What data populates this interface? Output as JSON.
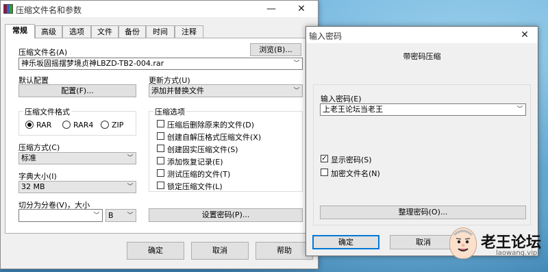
{
  "main_window": {
    "title": "压缩文件名和参数",
    "tabs": [
      "常规",
      "高级",
      "选项",
      "文件",
      "备份",
      "时间",
      "注释"
    ],
    "archive_name_label": "压缩文件名(A)",
    "browse_button": "浏览(B)...",
    "archive_name_value": "神乐坂固摇摆梦境贞神LBZD-TB2-004.rar",
    "default_profile_label": "默认配置",
    "profile_button": "配置(F)...",
    "update_mode_label": "更新方式(U)",
    "update_mode_value": "添加并替换文件",
    "format_group_title": "压缩文件格式",
    "format_options": [
      "RAR",
      "RAR4",
      "ZIP"
    ],
    "format_selected": "RAR",
    "method_label": "压缩方式(C)",
    "method_value": "标准",
    "dict_label": "字典大小(I)",
    "dict_value": "32 MB",
    "split_label": "切分为分卷(V)，大小",
    "split_value": "",
    "split_unit": "B",
    "options_group_title": "压缩选项",
    "options": [
      {
        "label": "压缩后删除原来的文件(D)",
        "checked": false
      },
      {
        "label": "创建自解压格式压缩文件(X)",
        "checked": false
      },
      {
        "label": "创建固实压缩文件(S)",
        "checked": false
      },
      {
        "label": "添加恢复记录(E)",
        "checked": false
      },
      {
        "label": "测试压缩的文件(T)",
        "checked": false
      },
      {
        "label": "锁定压缩文件(L)",
        "checked": false
      }
    ],
    "set_password_button": "设置密码(P)...",
    "ok_button": "确定",
    "cancel_button": "取消",
    "help_button": "帮助"
  },
  "password_dialog": {
    "title": "输入密码",
    "heading": "带密码压缩",
    "password_label": "输入密码(E)",
    "password_value": "上老王论坛当老王",
    "show_password_label": "显示密码(S)",
    "show_password_checked": true,
    "encrypt_names_label": "加密文件名(N)",
    "encrypt_names_checked": false,
    "organize_button": "整理密码(O)...",
    "ok_button": "确定",
    "cancel_button": "取消"
  },
  "watermark": {
    "name": "老王论坛",
    "domain": "laowang.vip"
  },
  "icons": [
    "winrar-app-icon",
    "minimize-icon",
    "close-icon",
    "dropdown-arrow-icon"
  ]
}
